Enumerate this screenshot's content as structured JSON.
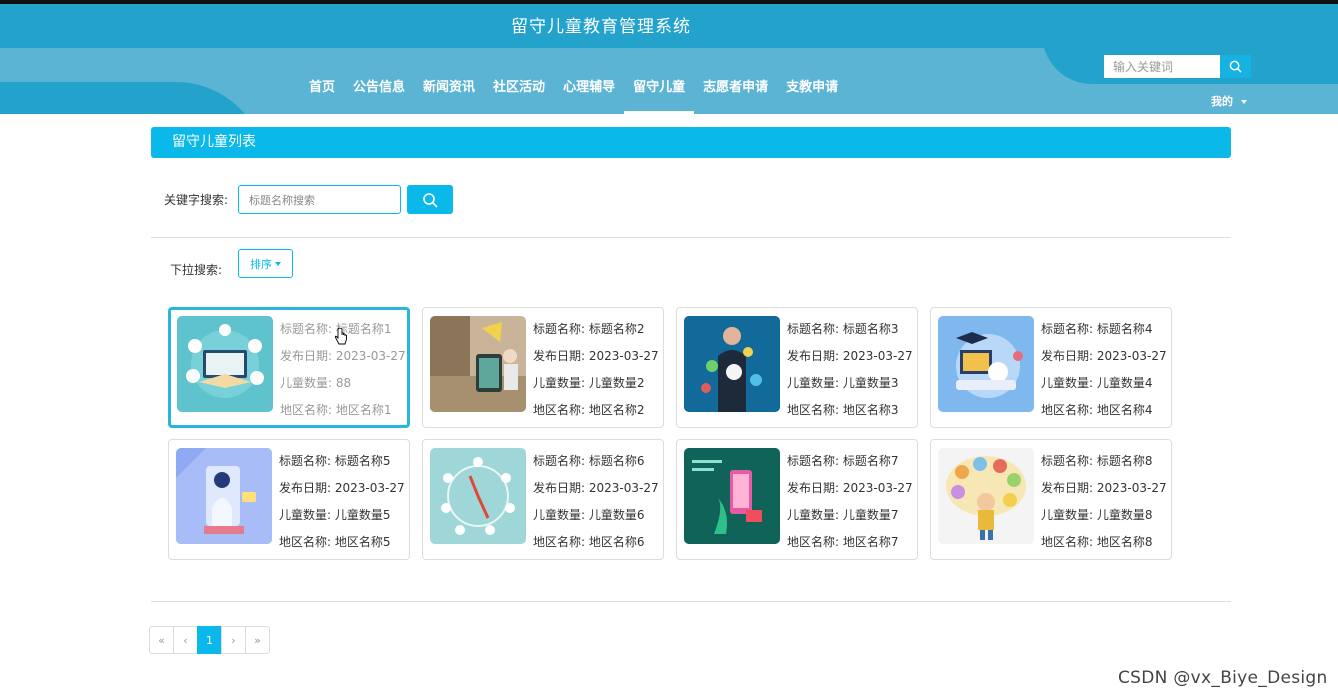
{
  "header": {
    "site_title": "留守儿童教育管理系统",
    "nav": [
      "首页",
      "公告信息",
      "新闻资讯",
      "社区活动",
      "心理辅导",
      "留守儿童",
      "志愿者申请",
      "支教申请"
    ],
    "active_nav": "留守儿童",
    "search_placeholder": "输入关键词",
    "mine_label": "我的"
  },
  "main": {
    "section_title": "留守儿童列表",
    "keyword_label": "关键字搜索:",
    "keyword_placeholder": "标题名称搜索",
    "dropdown_label": "下拉搜索:",
    "sort_label": "排序"
  },
  "cards": [
    {
      "title": "标题名称: 标题名称1",
      "date": "发布日期: 2023-03-27",
      "count": "儿童数量: 88",
      "region": "地区名称: 地区名称1"
    },
    {
      "title": "标题名称: 标题名称2",
      "date": "发布日期: 2023-03-27",
      "count": "儿童数量: 儿童数量2",
      "region": "地区名称: 地区名称2"
    },
    {
      "title": "标题名称: 标题名称3",
      "date": "发布日期: 2023-03-27",
      "count": "儿童数量: 儿童数量3",
      "region": "地区名称: 地区名称3"
    },
    {
      "title": "标题名称: 标题名称4",
      "date": "发布日期: 2023-03-27",
      "count": "儿童数量: 儿童数量4",
      "region": "地区名称: 地区名称4"
    },
    {
      "title": "标题名称: 标题名称5",
      "date": "发布日期: 2023-03-27",
      "count": "儿童数量: 儿童数量5",
      "region": "地区名称: 地区名称5"
    },
    {
      "title": "标题名称: 标题名称6",
      "date": "发布日期: 2023-03-27",
      "count": "儿童数量: 儿童数量6",
      "region": "地区名称: 地区名称6"
    },
    {
      "title": "标题名称: 标题名称7",
      "date": "发布日期: 2023-03-27",
      "count": "儿童数量: 儿童数量7",
      "region": "地区名称: 地区名称7"
    },
    {
      "title": "标题名称: 标题名称8",
      "date": "发布日期: 2023-03-27",
      "count": "儿童数量: 儿童数量8",
      "region": "地区名称: 地区名称8"
    }
  ],
  "pagination": {
    "first": "«",
    "prev": "‹",
    "current": "1",
    "next": "›",
    "last": "»"
  },
  "watermark": "CSDN @vx_Biye_Design",
  "colors": {
    "header_dark": "#23a3cb",
    "header_light": "#5bb4d4",
    "accent": "#0ab8ea"
  }
}
